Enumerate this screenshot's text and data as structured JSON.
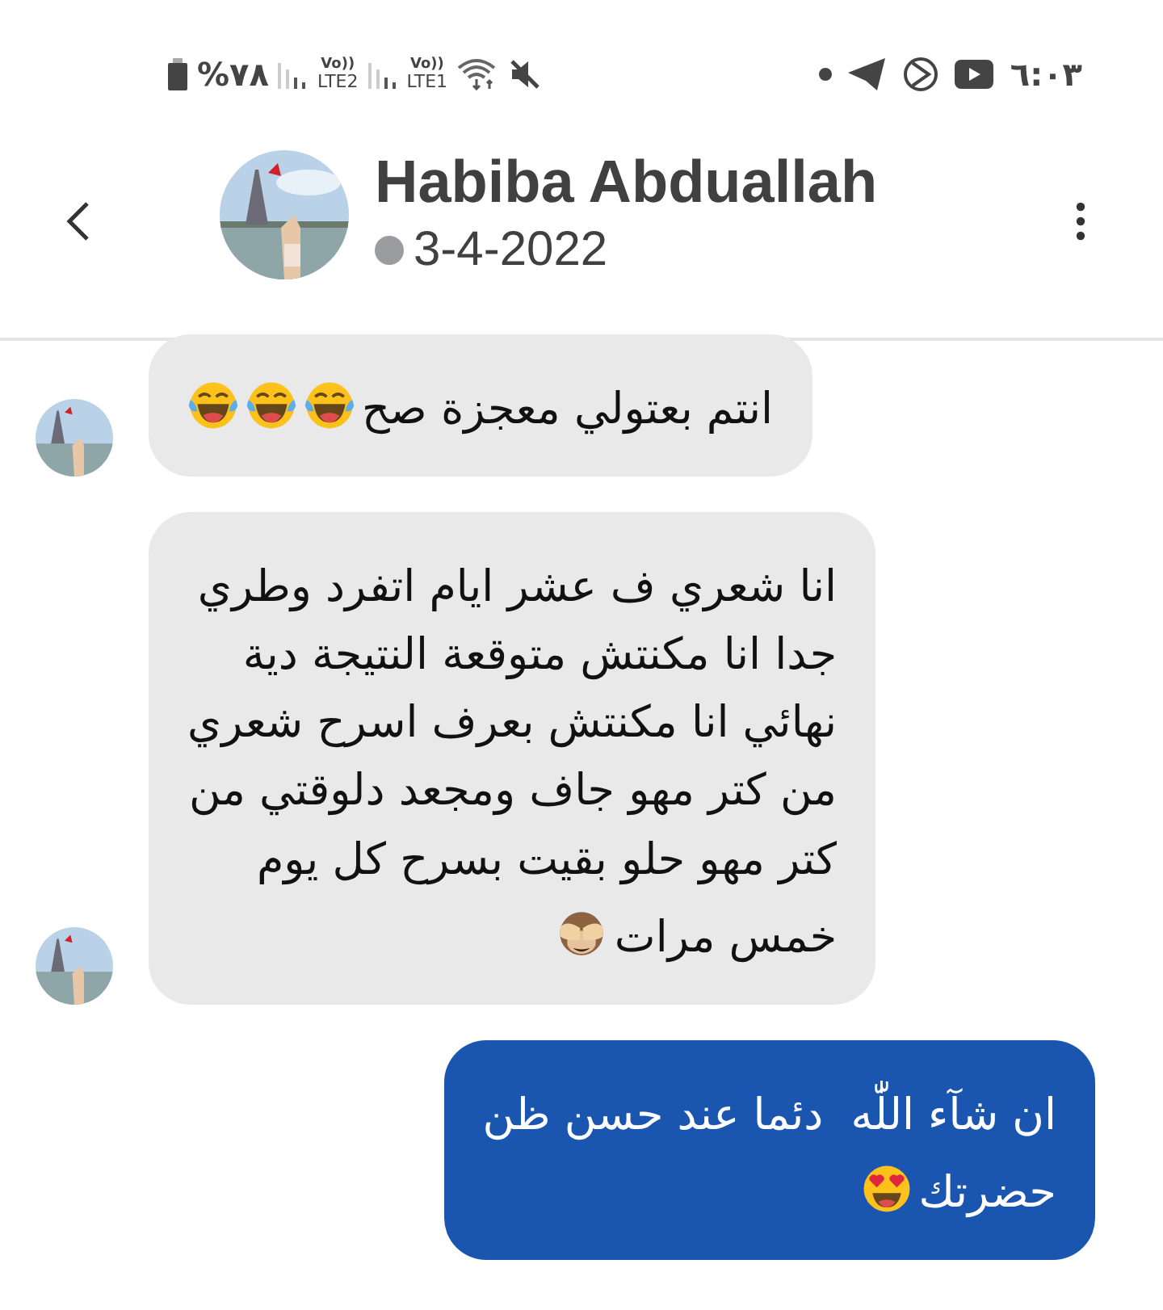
{
  "status_bar": {
    "battery_text": "%٧٨",
    "sim2": {
      "volte": "Vo))",
      "network": "LTE2"
    },
    "sim1": {
      "volte": "Vo))",
      "network": "LTE1"
    },
    "time": "٦:٠٣"
  },
  "header": {
    "name": "Habiba Abduallah",
    "last_seen": "3-4-2022"
  },
  "messages": [
    {
      "kind": "incoming",
      "last_line": "انتم بعتولي معجزة صح",
      "emoji": [
        {
          "kind": "laughing"
        },
        {
          "kind": "laughing"
        },
        {
          "kind": "laughing"
        }
      ]
    },
    {
      "kind": "incoming",
      "text": "انا شعري ف عشر ايام اتفرد وطري\nجدا انا مكنتش متوقعة النتيجة دية\nنهائي انا مكنتش بعرف اسرح شعري\nمن كتر مهو جاف ومجعد دلوقتي من\nكتر مهو حلو بقيت بسرح كل يوم",
      "last_line": "خمس مرات",
      "emoji": [
        {
          "kind": "monkey"
        }
      ]
    },
    {
      "kind": "outgoing",
      "text": "ان شآء اللّٰه  دئما عند حسن ظن",
      "last_line": "حضرتك",
      "emoji": [
        {
          "kind": "heart-eyes"
        }
      ]
    }
  ]
}
